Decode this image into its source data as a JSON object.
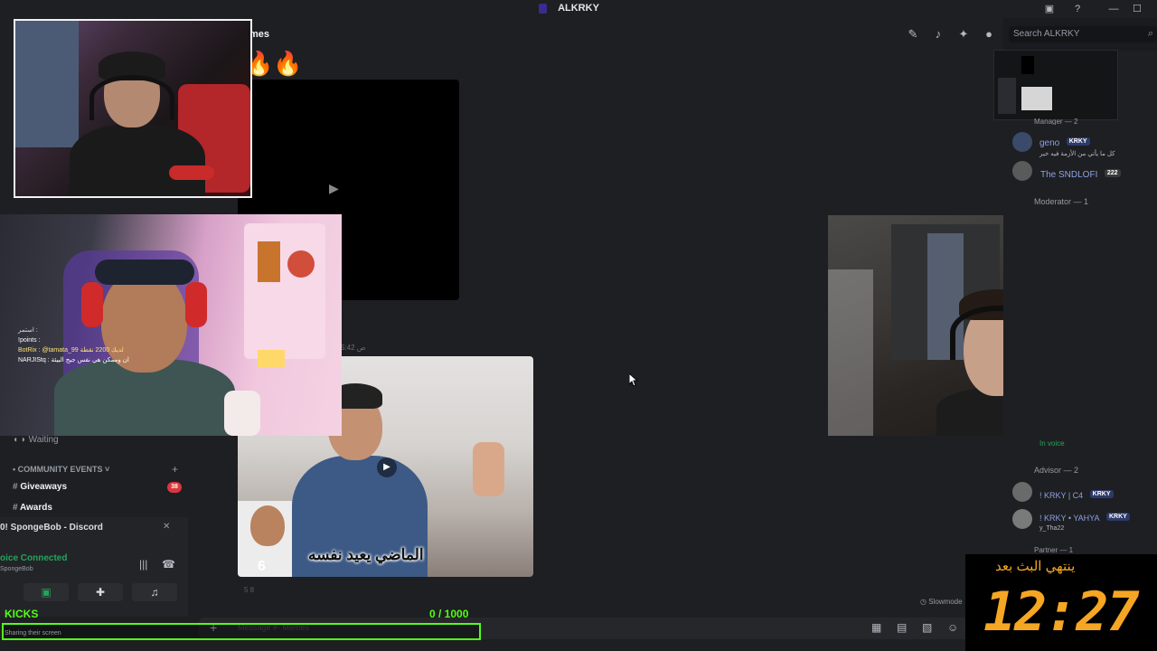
{
  "window": {
    "title": "ALKRKY",
    "controls": [
      "—",
      "☐",
      "✕"
    ]
  },
  "channel": {
    "name": "mes",
    "search_placeholder": "Search ALKRKY",
    "timestamp": "5:42 ص",
    "reactions": "5   8"
  },
  "sidebar": {
    "waiting_label": "Waiting",
    "category": "COMMUNITY EVENTS",
    "channels": [
      {
        "label": "Giveaways",
        "badge": "38"
      },
      {
        "label": "Awards",
        "badge": ""
      }
    ]
  },
  "voice": {
    "title": "0! SpongeBob - Discord",
    "status": "oice Connected",
    "sub": "SpongeBob"
  },
  "composer": {
    "placeholder": "Message #· Memes",
    "slowmode": "Slowmode"
  },
  "kicks": {
    "label": "KICKS",
    "count": "0   / 1000",
    "sharing": "Sharing their screen"
  },
  "members": {
    "roles": [
      {
        "label": "Manager — 2"
      },
      {
        "label": "Moderator — 1"
      },
      {
        "label": "Advisor — 2"
      },
      {
        "label": "Partner — 1"
      }
    ],
    "entries": [
      {
        "name": "geno",
        "tag": "KRKY",
        "status": "كل ما يأتي من الأزمة فيه خير"
      },
      {
        "name": "The SNDLOFI",
        "tag": "222",
        "status": ""
      },
      {
        "name": "In voice",
        "tag": "",
        "status": ""
      },
      {
        "name": "! KRKY | C4",
        "tag": "KRKY",
        "status": ""
      },
      {
        "name": "! KRKY • YAHYA",
        "tag": "KRKY",
        "status": "y_Tha22"
      }
    ]
  },
  "overlay_chat": [
    "استمر :",
    "!points :",
    "BotRix : @tamata_99 لديك 2200 نقطة",
    "NARJIStq : ان وممكن هي نفس جيج البيئة"
  ],
  "video": {
    "caption": "الماضي يعيد نفسه",
    "number": "6"
  },
  "timer": {
    "label": "ينتهي البث بعد",
    "value": "12:27"
  },
  "colors": {
    "kick_green": "#53fc18",
    "timer_orange": "#f5a623",
    "discord_green": "#23a55a"
  }
}
